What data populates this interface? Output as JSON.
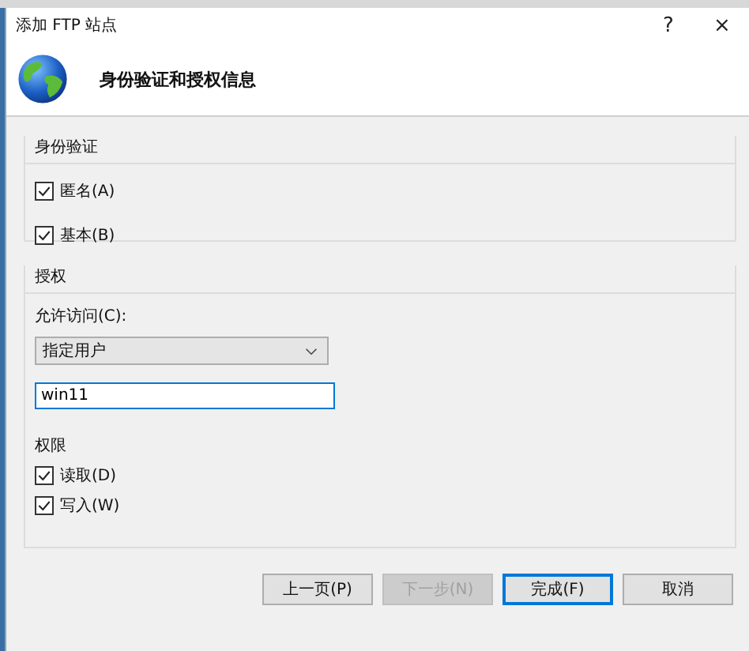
{
  "window": {
    "title": "添加 FTP 站点",
    "help": "?",
    "close": "×"
  },
  "header": {
    "title": "身份验证和授权信息"
  },
  "authentication": {
    "title": "身份验证",
    "options": [
      {
        "label": "匿名(A)",
        "checked": true
      },
      {
        "label": "基本(B)",
        "checked": true
      }
    ]
  },
  "authorization": {
    "title": "授权",
    "access_label": "允许访问(C):",
    "access_value": "指定用户",
    "user_value": "win11",
    "permissions_title": "权限",
    "permissions": [
      {
        "label": "读取(D)",
        "checked": true
      },
      {
        "label": "写入(W)",
        "checked": true
      }
    ]
  },
  "buttons": [
    {
      "label": "上一页(P)",
      "disabled": false,
      "default": false
    },
    {
      "label": "下一步(N)",
      "disabled": true,
      "default": false
    },
    {
      "label": "完成(F)",
      "disabled": false,
      "default": true
    },
    {
      "label": "取消",
      "disabled": false,
      "default": false
    }
  ]
}
